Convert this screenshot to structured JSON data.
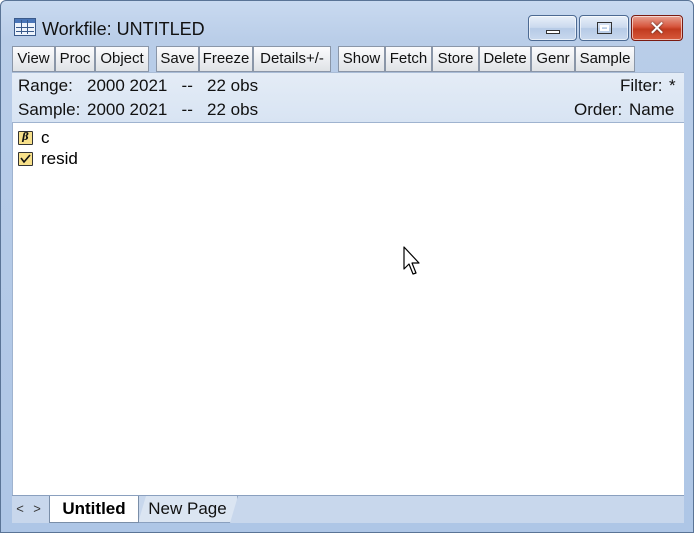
{
  "window": {
    "title": "Workfile: UNTITLED",
    "close_glyph": "✕"
  },
  "toolbar": {
    "buttons": [
      "View",
      "Proc",
      "Object",
      "Save",
      "Freeze",
      "Details+/-",
      "Show",
      "Fetch",
      "Store",
      "Delete",
      "Genr",
      "Sample"
    ]
  },
  "info": {
    "range_label": "Range:",
    "range_value": "2000 2021   --   22 obs",
    "sample_label": "Sample:",
    "sample_value": "2000 2021   --   22 obs",
    "filter_label": "Filter:",
    "filter_value": "*",
    "order_label": "Order:",
    "order_value": "Name"
  },
  "objects": [
    {
      "name": "c",
      "icon": "coefficient-vector-icon",
      "glyph": "β"
    },
    {
      "name": "resid",
      "icon": "series-icon",
      "glyph": ""
    }
  ],
  "tabs": {
    "nav_left": "<",
    "nav_right": ">",
    "active": "Untitled",
    "other": "New Page"
  }
}
